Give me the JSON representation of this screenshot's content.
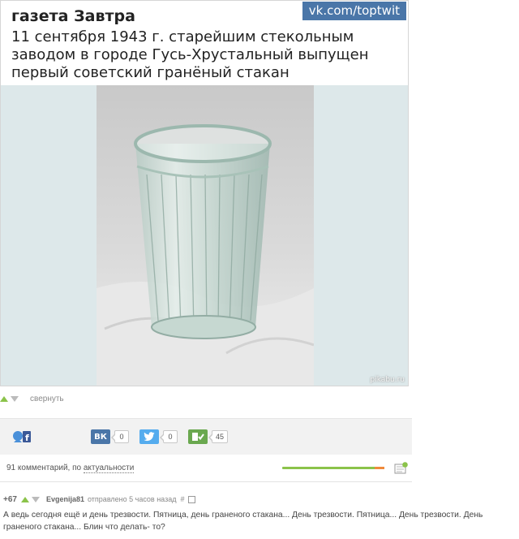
{
  "post": {
    "source_name": "газета Завтра",
    "vk_badge": "vk.com/toptwit",
    "headline": "11 сентября 1943 г. старейшим стекольным заводом в городе Гусь-Хрустальный выпущен первый советский гранёный стакан",
    "watermark": "pikabu.ru"
  },
  "rating_row": {
    "collapse_label": "свернуть"
  },
  "share": {
    "vk": {
      "icon": "vk-icon",
      "label": "ВК",
      "count": "0"
    },
    "twitter": {
      "icon": "twitter-icon",
      "count": "0"
    },
    "save": {
      "icon": "save-icon",
      "count": "45"
    }
  },
  "comments": {
    "count_label": "91 комментарий, по ",
    "sort_label": "актуальности"
  },
  "comment": {
    "rating": "+67",
    "user": "Evgenija81",
    "time": "отправлено 5 часов назад",
    "hash": "#",
    "text": "А ведь сегодня ещё и день трезвости. Пятница, день граненого стакана... День трезвости. Пятница... День трезвости. День граненого стакана... Блин что делать- то?"
  },
  "colors": {
    "vk_blue": "#4a76a8",
    "twitter_blue": "#55acee",
    "save_green": "#6aa84f",
    "rating_green": "#8bc34a",
    "rating_orange": "#f08a3c"
  }
}
